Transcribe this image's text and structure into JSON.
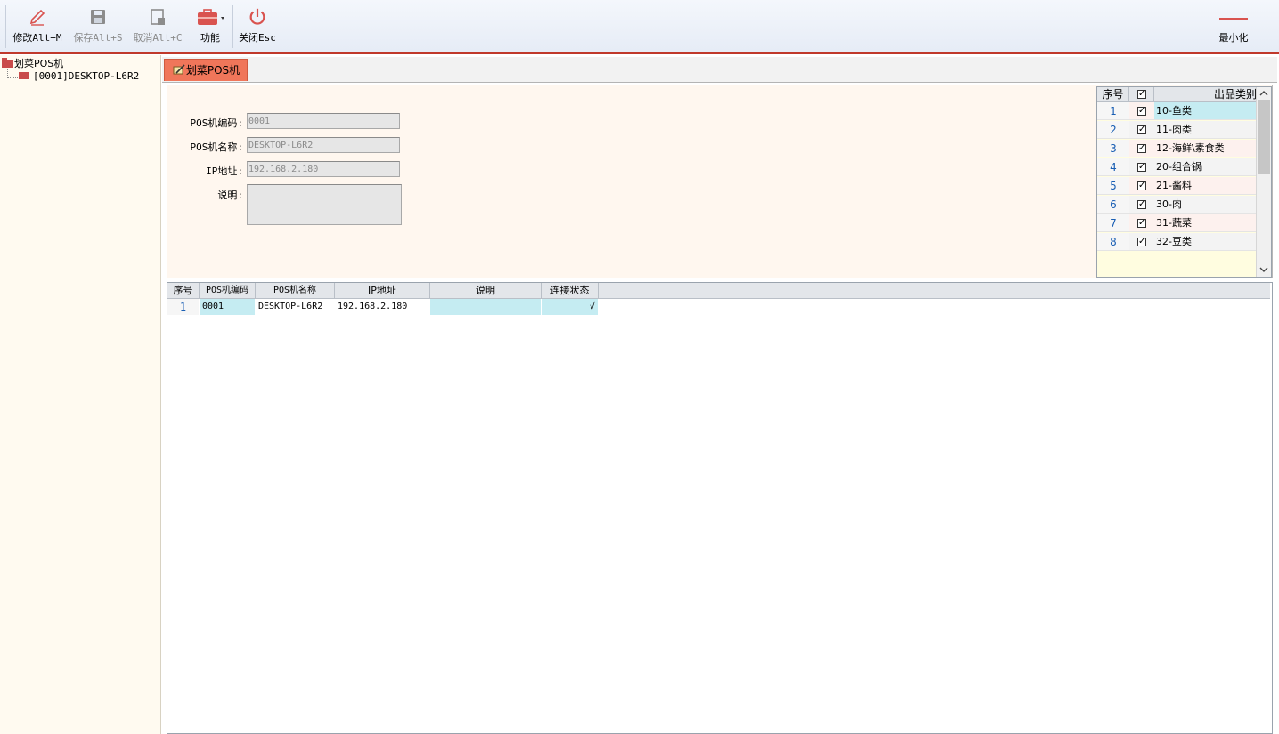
{
  "toolbar": {
    "edit": "修改Alt+M",
    "save": "保存Alt+S",
    "cancel": "取消Alt+C",
    "function": "功能",
    "close": "关闭Esc",
    "minimize": "最小化"
  },
  "tree": {
    "root": "划菜POS机",
    "child": "[0001]DESKTOP-L6R2"
  },
  "tab": {
    "label": "划菜POS机"
  },
  "form": {
    "code_label": "POS机编码:",
    "code_value": "0001",
    "name_label": "POS机名称:",
    "name_value": "DESKTOP-L6R2",
    "ip_label": "IP地址:",
    "ip_value": "192.168.2.180",
    "desc_label": "说明:",
    "desc_value": ""
  },
  "category_grid": {
    "headers": {
      "seq": "序号",
      "category": "出品类别"
    },
    "rows": [
      {
        "seq": "1",
        "name": "10-鱼类",
        "checked": true
      },
      {
        "seq": "2",
        "name": "11-肉类",
        "checked": true
      },
      {
        "seq": "3",
        "name": "12-海鲜\\素食类",
        "checked": true
      },
      {
        "seq": "4",
        "name": "20-组合锅",
        "checked": true
      },
      {
        "seq": "5",
        "name": "21-酱料",
        "checked": true
      },
      {
        "seq": "6",
        "name": "30-肉",
        "checked": true
      },
      {
        "seq": "7",
        "name": "31-蔬菜",
        "checked": true
      },
      {
        "seq": "8",
        "name": "32-豆类",
        "checked": true
      }
    ]
  },
  "list_grid": {
    "headers": {
      "seq": "序号",
      "code": "POS机编码",
      "name": "POS机名称",
      "ip": "IP地址",
      "desc": "说明",
      "status": "连接状态"
    },
    "rows": [
      {
        "seq": "1",
        "code": "0001",
        "name": "DESKTOP-L6R2",
        "ip": "192.168.2.180",
        "desc": "",
        "status": "√"
      }
    ]
  },
  "colors": {
    "accent_red": "#c0392b",
    "tab_orange": "#f0765a",
    "selected_cyan": "#c5ecf2",
    "form_bg": "#fff7ef",
    "tree_bg": "#fffaf0"
  }
}
